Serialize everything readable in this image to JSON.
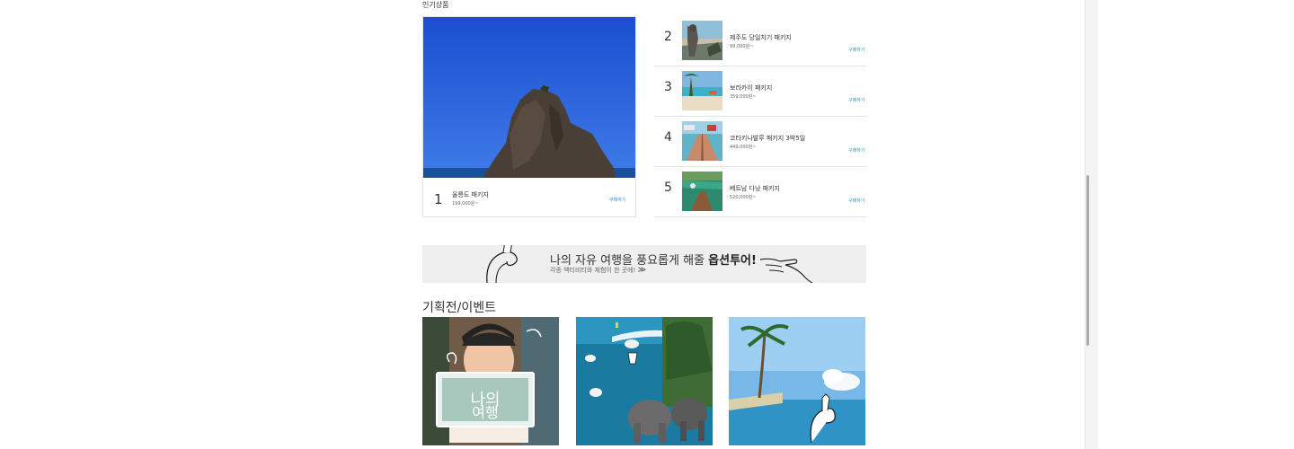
{
  "popular": {
    "title": "인기상품",
    "featured": {
      "rank": "1",
      "name": "울릉도 패키지",
      "price": "199,000원~",
      "buy_label": "구매하기"
    },
    "items": [
      {
        "rank": "2",
        "name": "제주도 당일치기 패키지",
        "price": "99,000원~",
        "buy_label": "구매하기"
      },
      {
        "rank": "3",
        "name": "보라카이 패키지",
        "price": "359,000원~",
        "buy_label": "구매하기"
      },
      {
        "rank": "4",
        "name": "코타키나발루 패키지 3박5일",
        "price": "449,000원~",
        "buy_label": "구매하기"
      },
      {
        "rank": "5",
        "name": "베트남 다낭 패키지",
        "price": "520,000원~",
        "buy_label": "구매하기"
      }
    ]
  },
  "banner": {
    "headline_regular": "나의 자유 여행을 풍요롭게 해줄 ",
    "headline_bold": "옵션투어!",
    "subtext": "각종 액티비티와 체험이 한 곳에!",
    "arrow": "≫"
  },
  "events": {
    "title": "기획전/이벤트",
    "logo_text_top": "나의",
    "logo_text_bottom": "여행"
  }
}
